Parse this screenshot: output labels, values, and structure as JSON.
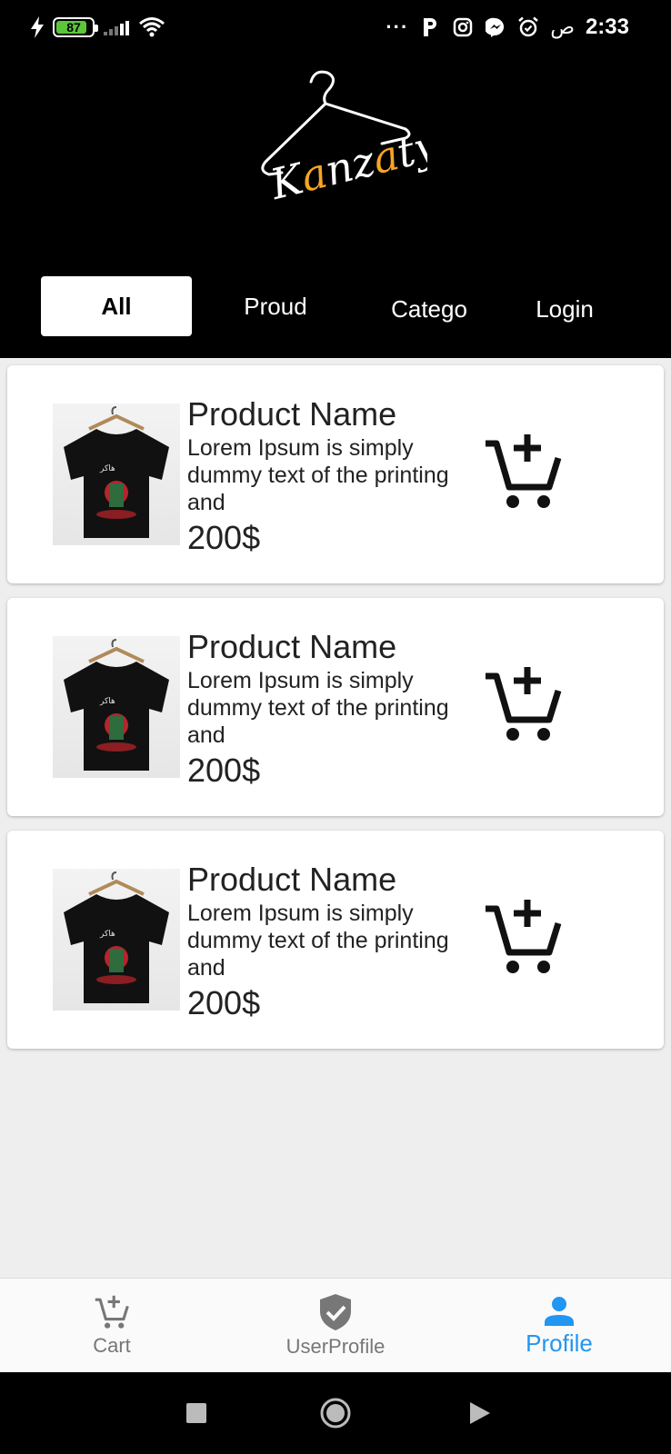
{
  "status_bar": {
    "battery": "87",
    "battery_level": 0.87,
    "time": "2:33",
    "time_suffix": "ص",
    "more": "···",
    "notification_icons": [
      "flash-icon",
      "parking-icon",
      "instagram-icon",
      "messenger-icon",
      "alarm-icon"
    ]
  },
  "app": {
    "logo_text": "Kanzaty",
    "logo_accent_color": "#f5a623"
  },
  "tabs": [
    {
      "label": "All",
      "active": true
    },
    {
      "label": "Proud",
      "active": false
    },
    {
      "label": "Catego",
      "active": false
    },
    {
      "label": "Login",
      "active": false
    }
  ],
  "products": [
    {
      "name": "Product Name",
      "description": "Lorem Ipsum is simply dummy text of the printing and",
      "price": "200$"
    },
    {
      "name": "Product Name",
      "description": "Lorem Ipsum is simply dummy text of the printing and",
      "price": "200$"
    },
    {
      "name": "Product Name",
      "description": "Lorem Ipsum is simply dummy text of the printing and",
      "price": "200$"
    }
  ],
  "bottom_nav": {
    "items": [
      {
        "label": "Cart",
        "icon": "cart-add-icon",
        "active": false
      },
      {
        "label": "UserProfile",
        "icon": "shield-check-icon",
        "active": false
      },
      {
        "label": "Profile",
        "icon": "person-icon",
        "active": true
      }
    ],
    "active_color": "#2196f3"
  },
  "system_nav": [
    "recents-icon",
    "home-icon",
    "back-icon"
  ]
}
